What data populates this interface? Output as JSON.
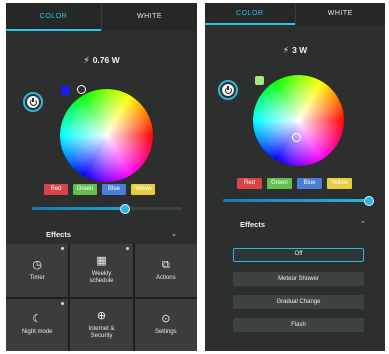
{
  "left": {
    "tabs": [
      {
        "label": "COLOR",
        "selected": true
      },
      {
        "label": "WHITE",
        "selected": false
      }
    ],
    "power_reading": "0.76 W",
    "power_button_icon": "power-icon",
    "selected_swatch_color": "#1a1aff",
    "color_chips": [
      {
        "label": "Red",
        "color": "#d94448"
      },
      {
        "label": "Green",
        "color": "#63c04e"
      },
      {
        "label": "Blue",
        "color": "#4b7ed8"
      },
      {
        "label": "Yellow",
        "color": "#e6cf3c"
      }
    ],
    "brightness": 0.62,
    "effects": {
      "title": "Effects",
      "expanded": false
    },
    "grid": [
      {
        "label": "Timer",
        "icon": "clock-icon",
        "dot": true
      },
      {
        "label": "Weekly schedule",
        "icon": "calendar-icon",
        "dot": true
      },
      {
        "label": "Actions",
        "icon": "actions-icon",
        "dot": false
      },
      {
        "label": "Night mode",
        "icon": "moon-icon",
        "dot": true
      },
      {
        "label": "Internet & Security",
        "icon": "globe-icon",
        "dot": false
      },
      {
        "label": "Settings",
        "icon": "settings-icon",
        "dot": false
      }
    ]
  },
  "right": {
    "tabs": [
      {
        "label": "COLOR",
        "selected": true
      },
      {
        "label": "WHITE",
        "selected": false
      }
    ],
    "power_reading": "3 W",
    "power_button_icon": "power-icon",
    "selected_swatch_color": "#a6e87a",
    "color_chips": [
      {
        "label": "Red",
        "color": "#d94448"
      },
      {
        "label": "Green",
        "color": "#63c04e"
      },
      {
        "label": "Blue",
        "color": "#4b7ed8"
      },
      {
        "label": "Yellow",
        "color": "#e6cf3c"
      }
    ],
    "brightness": 0.97,
    "effects": {
      "title": "Effects",
      "expanded": true
    },
    "effect_options": [
      {
        "label": "Off",
        "selected": true
      },
      {
        "label": "Meteor Shower",
        "selected": false
      },
      {
        "label": "Gradual Change",
        "selected": false
      },
      {
        "label": "Flash",
        "selected": false
      }
    ]
  },
  "colors": {
    "accent": "#29b7e8",
    "panel": "#2d2f2f",
    "tile": "#3b3d3d"
  }
}
